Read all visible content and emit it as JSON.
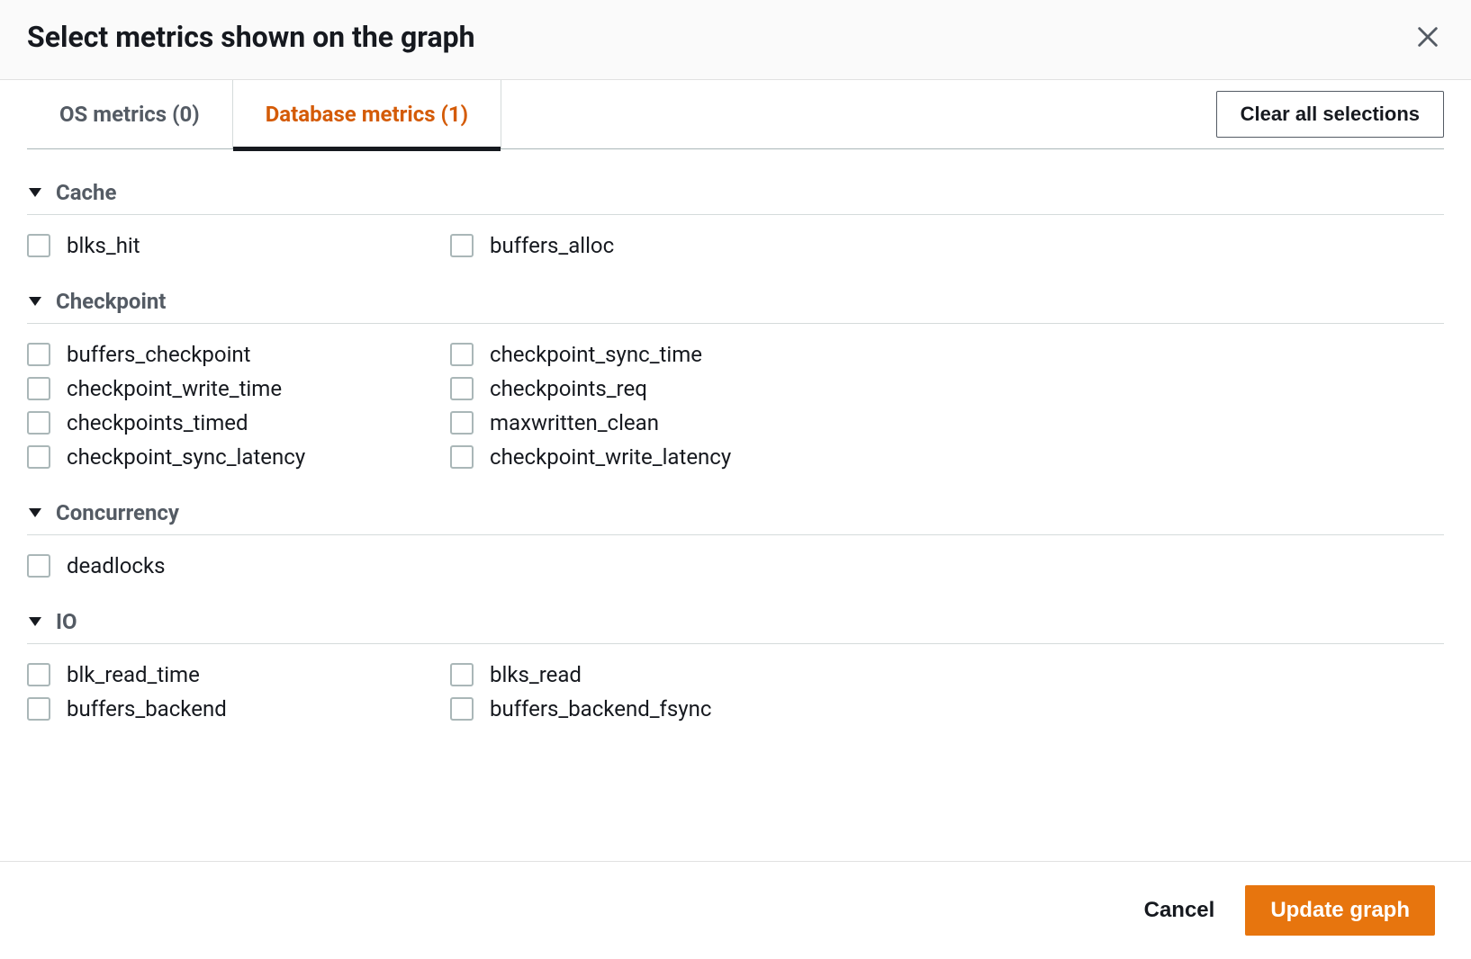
{
  "dialog": {
    "title": "Select metrics shown on the graph"
  },
  "tabs": {
    "os": "OS metrics (0)",
    "db": "Database metrics (1)"
  },
  "buttons": {
    "clear": "Clear all selections",
    "cancel": "Cancel",
    "update": "Update graph"
  },
  "sections": {
    "cache": {
      "title": "Cache",
      "items": {
        "blks_hit": "blks_hit",
        "buffers_alloc": "buffers_alloc"
      }
    },
    "checkpoint": {
      "title": "Checkpoint",
      "items": {
        "buffers_checkpoint": "buffers_checkpoint",
        "checkpoint_sync_time": "checkpoint_sync_time",
        "checkpoint_write_time": "checkpoint_write_time",
        "checkpoints_req": "checkpoints_req",
        "checkpoints_timed": "checkpoints_timed",
        "maxwritten_clean": "maxwritten_clean",
        "checkpoint_sync_latency": "checkpoint_sync_latency",
        "checkpoint_write_latency": "checkpoint_write_latency"
      }
    },
    "concurrency": {
      "title": "Concurrency",
      "items": {
        "deadlocks": "deadlocks"
      }
    },
    "io": {
      "title": "IO",
      "items": {
        "blk_read_time": "blk_read_time",
        "blks_read": "blks_read",
        "buffers_backend": "buffers_backend",
        "buffers_backend_fsync": "buffers_backend_fsync"
      }
    }
  }
}
